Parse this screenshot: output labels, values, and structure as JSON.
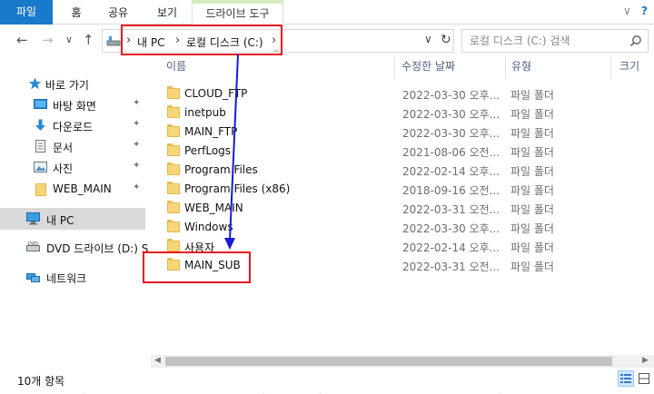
{
  "ribbon": {
    "tabs": [
      {
        "label": "파일"
      },
      {
        "label": "홈"
      },
      {
        "label": "공유"
      },
      {
        "label": "보기"
      },
      {
        "label": "드라이브 도구"
      }
    ],
    "collapse_glyph": "∨",
    "help_glyph": "?"
  },
  "nav": {
    "back": "←",
    "forward": "→",
    "recent": "∨",
    "up": "↑"
  },
  "address": {
    "separator": "›",
    "crumbs": [
      "내 PC",
      "로컬 디스크 (C:)"
    ],
    "dropdown": "∨",
    "refresh": "↻"
  },
  "search": {
    "placeholder": "로컬 디스크 (C:) 검색"
  },
  "sidebar": {
    "items": [
      {
        "label": "바로 가기",
        "icon": "star-icon"
      },
      {
        "label": "바탕 화면",
        "icon": "desktop-icon"
      },
      {
        "label": "다운로드",
        "icon": "download-icon"
      },
      {
        "label": "문서",
        "icon": "document-icon"
      },
      {
        "label": "사진",
        "icon": "pictures-icon"
      },
      {
        "label": "WEB_MAIN",
        "icon": "folder-icon"
      },
      {
        "label": "내 PC",
        "icon": "computer-icon"
      },
      {
        "label": "DVD 드라이브 (D:) S",
        "icon": "dvd-drive-icon"
      },
      {
        "label": "네트워크",
        "icon": "network-icon"
      }
    ],
    "pin_glyph": "📌"
  },
  "columns": {
    "name": "이름",
    "modified": "수정한 날짜",
    "type": "유형",
    "size": "크기",
    "sort_glyph": "^"
  },
  "files": [
    {
      "name": "CLOUD_FTP",
      "date": "2022-03-30 오후...",
      "type": "파일 폴더"
    },
    {
      "name": "inetpub",
      "date": "2022-03-30 오후...",
      "type": "파일 폴더"
    },
    {
      "name": "MAIN_FTP",
      "date": "2022-03-30 오후...",
      "type": "파일 폴더"
    },
    {
      "name": "PerfLogs",
      "date": "2021-08-06 오전...",
      "type": "파일 폴더"
    },
    {
      "name": "Program Files",
      "date": "2022-02-14 오후...",
      "type": "파일 폴더"
    },
    {
      "name": "Program Files (x86)",
      "date": "2018-09-16 오전...",
      "type": "파일 폴더"
    },
    {
      "name": "WEB_MAIN",
      "date": "2022-03-31 오전...",
      "type": "파일 폴더"
    },
    {
      "name": "Windows",
      "date": "2022-03-30 오후...",
      "type": "파일 폴더"
    },
    {
      "name": "사용자",
      "date": "2022-02-14 오후...",
      "type": "파일 폴더"
    },
    {
      "name": "MAIN_SUB",
      "date": "2022-03-31 오전...",
      "type": "파일 폴더"
    }
  ],
  "status": {
    "item_count": "10개 항목"
  },
  "colors": {
    "file_tab": "#1979ca",
    "highlight": "#e8161b",
    "arrow": "#1a1ad6",
    "selected": "#d9d9d9"
  }
}
